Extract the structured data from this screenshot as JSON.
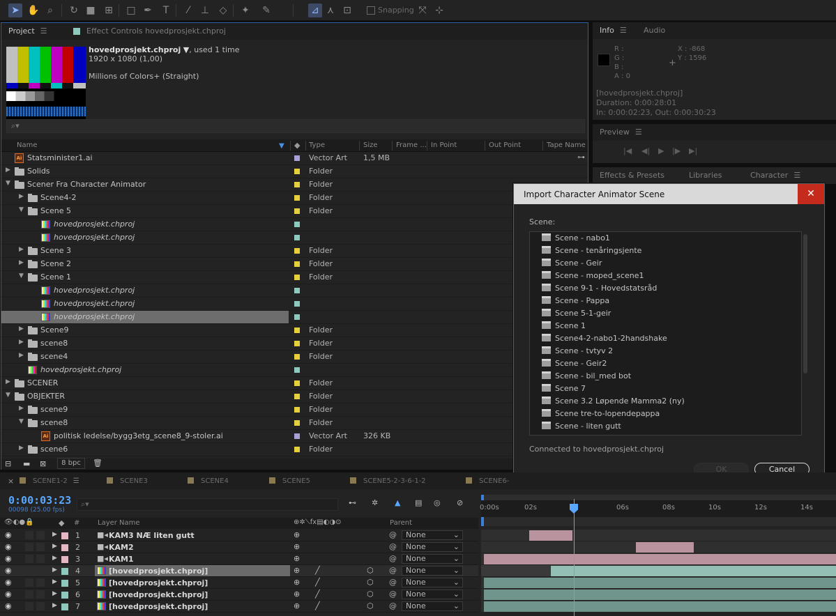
{
  "toolbar": {
    "snapping_label": "Snapping"
  },
  "project": {
    "tab_project": "Project",
    "tab_effect_controls": "Effect Controls hovedprosjekt.chproj",
    "item_name": "hovedprosjekt.chproj",
    "item_used": ", used 1 time",
    "item_dims": "1920 x 1080 (1,00)",
    "item_color": "Millions of Colors+ (Straight)",
    "search_placeholder": "",
    "columns": {
      "name": "Name",
      "type": "Type",
      "size": "Size",
      "frame": "Frame ...",
      "in": "In Point",
      "out": "Out Point",
      "tape": "Tape Name"
    },
    "rows": [
      {
        "indent": 0,
        "icon": "ai",
        "expand": "",
        "name": "Statsminister1.ai",
        "label": "#a9a2d6",
        "type": "Vector Art",
        "size": "1,5 MB",
        "italic": false
      },
      {
        "indent": 0,
        "icon": "folder",
        "expand": "▶",
        "name": "Solids",
        "label": "#e6cf3c",
        "type": "Folder",
        "size": "",
        "italic": false
      },
      {
        "indent": 0,
        "icon": "folder",
        "expand": "▼",
        "name": "Scener Fra Character Animator",
        "label": "#e6cf3c",
        "type": "Folder",
        "size": "",
        "italic": false
      },
      {
        "indent": 1,
        "icon": "folder",
        "expand": "▶",
        "name": "Scene4-2",
        "label": "#e6cf3c",
        "type": "Folder",
        "size": "",
        "italic": false
      },
      {
        "indent": 1,
        "icon": "folder",
        "expand": "▼",
        "name": "Scene 5",
        "label": "#e6cf3c",
        "type": "Folder",
        "size": "",
        "italic": false
      },
      {
        "indent": 2,
        "icon": "comp",
        "expand": "",
        "name": "hovedprosjekt.chproj",
        "label": "#8ec9bd",
        "type": "",
        "size": "",
        "italic": true
      },
      {
        "indent": 2,
        "icon": "comp",
        "expand": "",
        "name": "hovedprosjekt.chproj",
        "label": "#8ec9bd",
        "type": "",
        "size": "",
        "italic": true
      },
      {
        "indent": 1,
        "icon": "folder",
        "expand": "▶",
        "name": "Scene 3",
        "label": "#e6cf3c",
        "type": "Folder",
        "size": "",
        "italic": false
      },
      {
        "indent": 1,
        "icon": "folder",
        "expand": "▶",
        "name": "Scene 2",
        "label": "#e6cf3c",
        "type": "Folder",
        "size": "",
        "italic": false
      },
      {
        "indent": 1,
        "icon": "folder",
        "expand": "▼",
        "name": "Scene 1",
        "label": "#e6cf3c",
        "type": "Folder",
        "size": "",
        "italic": false
      },
      {
        "indent": 2,
        "icon": "comp",
        "expand": "",
        "name": "hovedprosjekt.chproj",
        "label": "#8ec9bd",
        "type": "",
        "size": "",
        "italic": true
      },
      {
        "indent": 2,
        "icon": "comp",
        "expand": "",
        "name": "hovedprosjekt.chproj",
        "label": "#8ec9bd",
        "type": "",
        "size": "",
        "italic": true
      },
      {
        "indent": 2,
        "icon": "comp",
        "expand": "",
        "name": "hovedprosjekt.chproj",
        "label": "#8ec9bd",
        "type": "",
        "size": "",
        "italic": true,
        "selected": true
      },
      {
        "indent": 1,
        "icon": "folder",
        "expand": "▶",
        "name": "Scene9",
        "label": "#e6cf3c",
        "type": "Folder",
        "size": "",
        "italic": false
      },
      {
        "indent": 1,
        "icon": "folder",
        "expand": "▶",
        "name": "scene8",
        "label": "#e6cf3c",
        "type": "Folder",
        "size": "",
        "italic": false
      },
      {
        "indent": 1,
        "icon": "folder",
        "expand": "▶",
        "name": "scene4",
        "label": "#e6cf3c",
        "type": "Folder",
        "size": "",
        "italic": false
      },
      {
        "indent": 1,
        "icon": "comp",
        "expand": "",
        "name": "hovedprosjekt.chproj",
        "label": "#8ec9bd",
        "type": "",
        "size": "",
        "italic": true
      },
      {
        "indent": 0,
        "icon": "folder",
        "expand": "▶",
        "name": "SCENER",
        "label": "#e6cf3c",
        "type": "Folder",
        "size": "",
        "italic": false
      },
      {
        "indent": 0,
        "icon": "folder",
        "expand": "▼",
        "name": "OBJEKTER",
        "label": "#e6cf3c",
        "type": "Folder",
        "size": "",
        "italic": false
      },
      {
        "indent": 1,
        "icon": "folder",
        "expand": "▶",
        "name": "scene9",
        "label": "#e6cf3c",
        "type": "Folder",
        "size": "",
        "italic": false
      },
      {
        "indent": 1,
        "icon": "folder",
        "expand": "▼",
        "name": "scene8",
        "label": "#e6cf3c",
        "type": "Folder",
        "size": "",
        "italic": false
      },
      {
        "indent": 2,
        "icon": "ai",
        "expand": "",
        "name": "politisk ledelse/bygg3etg_scene8_9-stoler.ai",
        "label": "#a9a2d6",
        "type": "Vector Art",
        "size": "326 KB",
        "italic": false
      },
      {
        "indent": 1,
        "icon": "folder",
        "expand": "▶",
        "name": "scene6",
        "label": "#e6cf3c",
        "type": "Folder",
        "size": "",
        "italic": false
      }
    ],
    "bpc": "8 bpc"
  },
  "info": {
    "tab_info": "Info",
    "tab_audio": "Audio",
    "r": "R :",
    "g": "G :",
    "b": "B :",
    "a": "A : 0",
    "x": "X : -868",
    "y": "Y : 1596",
    "item": "[hovedprosjekt.chproj]",
    "duration": "Duration: 0:00:28:01",
    "inout": "In: 0:00:02:23, Out: 0:00:30:23"
  },
  "preview": {
    "tab": "Preview"
  },
  "effects": {
    "tab_effects": "Effects & Presets",
    "tab_libraries": "Libraries",
    "tab_character": "Character"
  },
  "dialog": {
    "title": "Import Character Animator Scene",
    "close": "✕",
    "scene_label": "Scene:",
    "scenes": [
      "Scene - nabo1",
      "Scene - tenåringsjente",
      "Scene - Geir",
      "Scene - moped_scene1",
      "Scene 9-1 - Hovedstatsråd",
      "Scene - Pappa",
      "Scene 5-1-geir",
      "Scene 1",
      "Scene4-2-nabo1-2handshake",
      "Scene - tvtyv 2",
      "Scene - Geir2",
      "Scene - bil_med bot",
      "Scene 7",
      "Scene 3.2 Løpende Mamma2 (ny)",
      "Scene tre-to-lopendepappa",
      "Scene - liten gutt"
    ],
    "connected": "Connected to hovedprosjekt.chproj",
    "ok": "OK",
    "cancel": "Cancel"
  },
  "timeline": {
    "tabs": [
      "SCENE1-2",
      "SCENE3",
      "SCENE4",
      "SCENE5",
      "SCENE5-2-3-6-1-2",
      "SCENE6-"
    ],
    "timecode": "0:00:03:23",
    "fps": "00098 (25.00 fps)",
    "col_layer": "Layer Name",
    "col_num": "#",
    "col_parent": "Parent",
    "ruler": [
      "0:00s",
      "02s",
      "",
      "06s",
      "08s",
      "10s",
      "12s",
      "14s"
    ],
    "layers": [
      {
        "num": "1",
        "name": "KAM3 NÆ liten gutt",
        "icon": "camera",
        "color": "#e6b7c3",
        "parent": "None"
      },
      {
        "num": "2",
        "name": "KAM2",
        "icon": "camera",
        "color": "#e6b7c3",
        "parent": "None"
      },
      {
        "num": "3",
        "name": "KAM1",
        "icon": "camera",
        "color": "#e6b7c3",
        "parent": "None"
      },
      {
        "num": "4",
        "name": "[hovedprosjekt.chproj]",
        "icon": "comp",
        "color": "#8ec9bd",
        "parent": "None",
        "selected": true
      },
      {
        "num": "5",
        "name": "[hovedprosjekt.chproj]",
        "icon": "comp",
        "color": "#8ec9bd",
        "parent": "None"
      },
      {
        "num": "6",
        "name": "[hovedprosjekt.chproj]",
        "icon": "comp",
        "color": "#8ec9bd",
        "parent": "None"
      },
      {
        "num": "7",
        "name": "[hovedprosjekt.chproj]",
        "icon": "comp",
        "color": "#8ec9bd",
        "parent": "None"
      }
    ]
  }
}
